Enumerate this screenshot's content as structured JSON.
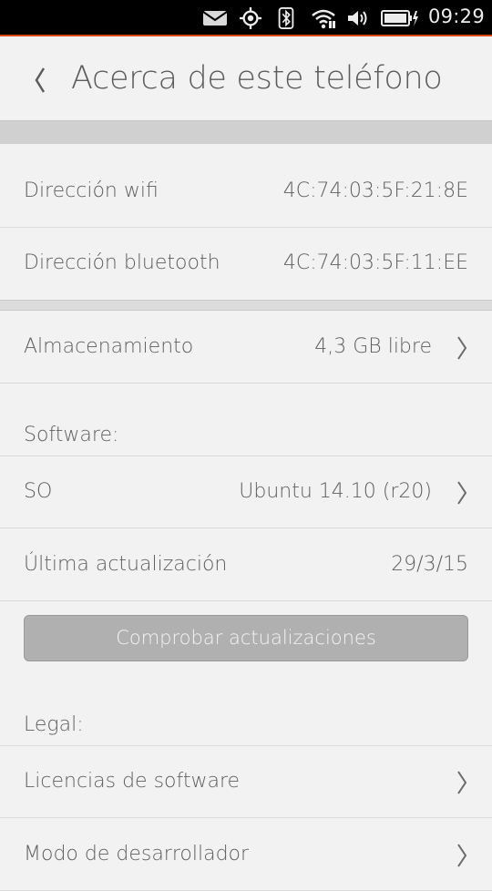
{
  "status_bar": {
    "time": "09:29",
    "icons": [
      "mail-icon",
      "location-icon",
      "bluetooth-icon",
      "wifi-icon",
      "volume-icon",
      "battery-charging-icon"
    ],
    "accent_color": "#dd4814"
  },
  "header": {
    "title": "Acerca de este teléfono",
    "back_icon": "chevron-left-icon"
  },
  "network": {
    "wifi_label": "Dirección wifi",
    "wifi_value": "4C:74:03:5F:21:8E",
    "bluetooth_label": "Dirección bluetooth",
    "bluetooth_value": "4C:74:03:5F:11:EE"
  },
  "storage": {
    "label": "Almacenamiento",
    "value": "4,3 GB libre"
  },
  "software": {
    "section_label": "Software:",
    "os_label": "SO",
    "os_value": "Ubuntu 14.10 (r20)",
    "last_update_label": "Última actualización",
    "last_update_value": "29/3/15",
    "check_button": "Comprobar actualizaciones"
  },
  "legal": {
    "section_label": "Legal:",
    "licenses_label": "Licencias de software",
    "developer_label": "Modo de desarrollador"
  }
}
